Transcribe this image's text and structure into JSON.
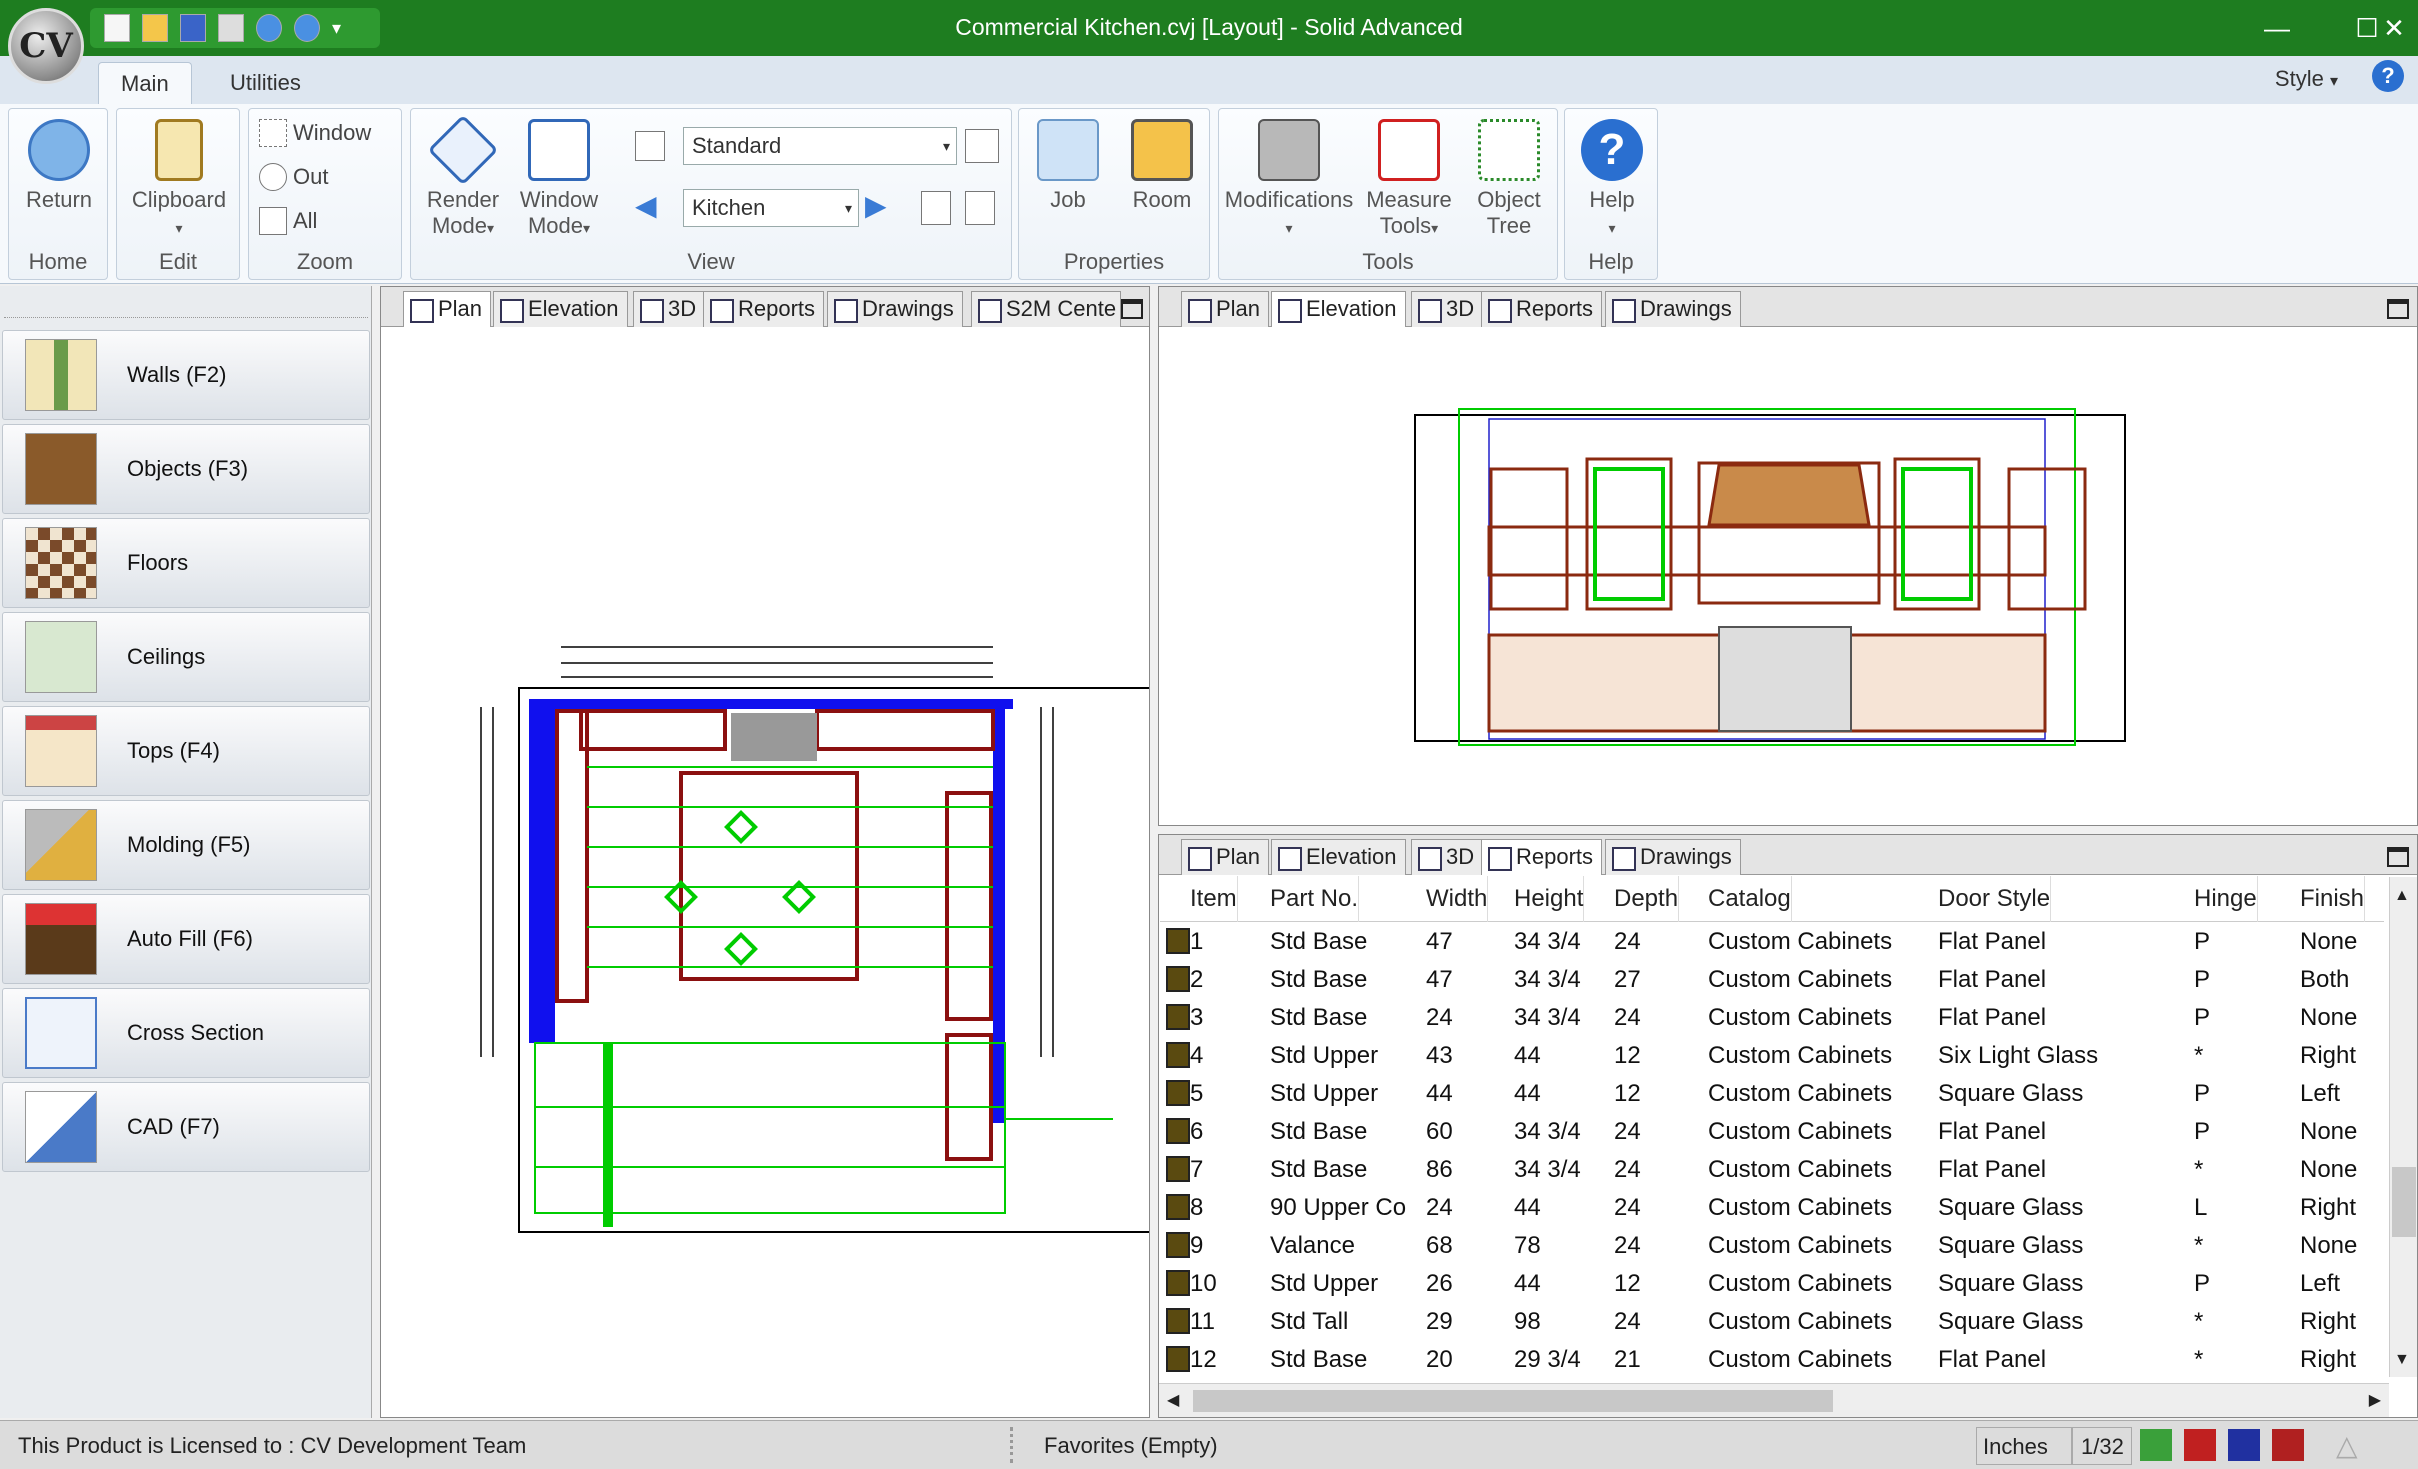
{
  "window": {
    "title": "Commercial Kitchen.cvj [Layout] - Solid Advanced",
    "logo": "CV",
    "minimize": "—",
    "maximize": "☐",
    "close": "✕"
  },
  "ribbon_tabs": [
    "Main",
    "Utilities"
  ],
  "style_menu": {
    "label": "Style"
  },
  "ribbon": {
    "home": {
      "return": "Return",
      "group": "Home"
    },
    "edit": {
      "clipboard": "Clipboard",
      "group": "Edit"
    },
    "zoom": {
      "window": "Window",
      "out": "Out",
      "all": "All",
      "group": "Zoom"
    },
    "view": {
      "render_mode": [
        "Render",
        "Mode"
      ],
      "window_mode": [
        "Window",
        "Mode"
      ],
      "standard": "Standard",
      "kitchen": "Kitchen",
      "group": "View"
    },
    "properties": {
      "job": "Job",
      "room": "Room",
      "group": "Properties"
    },
    "tools": {
      "modifications": "Modifications",
      "measure_tools": [
        "Measure",
        "Tools"
      ],
      "object_tree": [
        "Object",
        "Tree"
      ],
      "group": "Tools"
    },
    "help": {
      "help": "Help",
      "group": "Help"
    }
  },
  "nav_buttons": [
    "Walls (F2)",
    "Objects (F3)",
    "Floors",
    "Ceilings",
    "Tops (F4)",
    "Molding (F5)",
    "Auto Fill (F6)",
    "Cross Section",
    "CAD (F7)"
  ],
  "left_view_tabs": [
    "Plan",
    "Elevation",
    "3D",
    "Reports",
    "Drawings",
    "S2M Cente"
  ],
  "right_top_tabs": [
    "Plan",
    "Elevation",
    "3D",
    "Reports",
    "Drawings"
  ],
  "right_bottom_tabs": [
    "Plan",
    "Elevation",
    "3D",
    "Reports",
    "Drawings"
  ],
  "report": {
    "columns": [
      "Item",
      "Part No.",
      "Width",
      "Height",
      "Depth",
      "Catalog",
      "Door Style",
      "Hinge",
      "Finish"
    ],
    "rows": [
      [
        "1",
        "Std Base",
        "47",
        "34 3/4",
        "24",
        "Custom Cabinets",
        "Flat Panel",
        "P",
        "None"
      ],
      [
        "2",
        "Std Base",
        "47",
        "34 3/4",
        "27",
        "Custom Cabinets",
        "Flat Panel",
        "P",
        "Both"
      ],
      [
        "3",
        "Std Base",
        "24",
        "34 3/4",
        "24",
        "Custom Cabinets",
        "Flat Panel",
        "P",
        "None"
      ],
      [
        "4",
        "Std Upper",
        "43",
        "44",
        "12",
        "Custom Cabinets",
        "Six Light Glass",
        "*",
        "Right"
      ],
      [
        "5",
        "Std Upper",
        "44",
        "44",
        "12",
        "Custom Cabinets",
        "Square Glass",
        "P",
        "Left"
      ],
      [
        "6",
        "Std Base",
        "60",
        "34 3/4",
        "24",
        "Custom Cabinets",
        "Flat Panel",
        "P",
        "None"
      ],
      [
        "7",
        "Std Base",
        "86",
        "34 3/4",
        "24",
        "Custom Cabinets",
        "Flat Panel",
        "*",
        "None"
      ],
      [
        "8",
        "90 Upper Co",
        "24",
        "44",
        "24",
        "Custom Cabinets",
        "Square Glass",
        "L",
        "Right"
      ],
      [
        "9",
        "Valance",
        "68",
        "78",
        "24",
        "Custom Cabinets",
        "Square Glass",
        "*",
        "None"
      ],
      [
        "10",
        "Std Upper",
        "26",
        "44",
        "12",
        "Custom Cabinets",
        "Square Glass",
        "P",
        "Left"
      ],
      [
        "11",
        "Std Tall",
        "29",
        "98",
        "24",
        "Custom Cabinets",
        "Square Glass",
        "*",
        "Right"
      ],
      [
        "12",
        "Std Base",
        "20",
        "29 3/4",
        "21",
        "Custom Cabinets",
        "Flat Panel",
        "*",
        "Right"
      ]
    ]
  },
  "status": {
    "license": "This Product is Licensed to : CV Development Team",
    "favorites": "Favorites (Empty)",
    "units": "Inches",
    "precision": "1/32"
  }
}
